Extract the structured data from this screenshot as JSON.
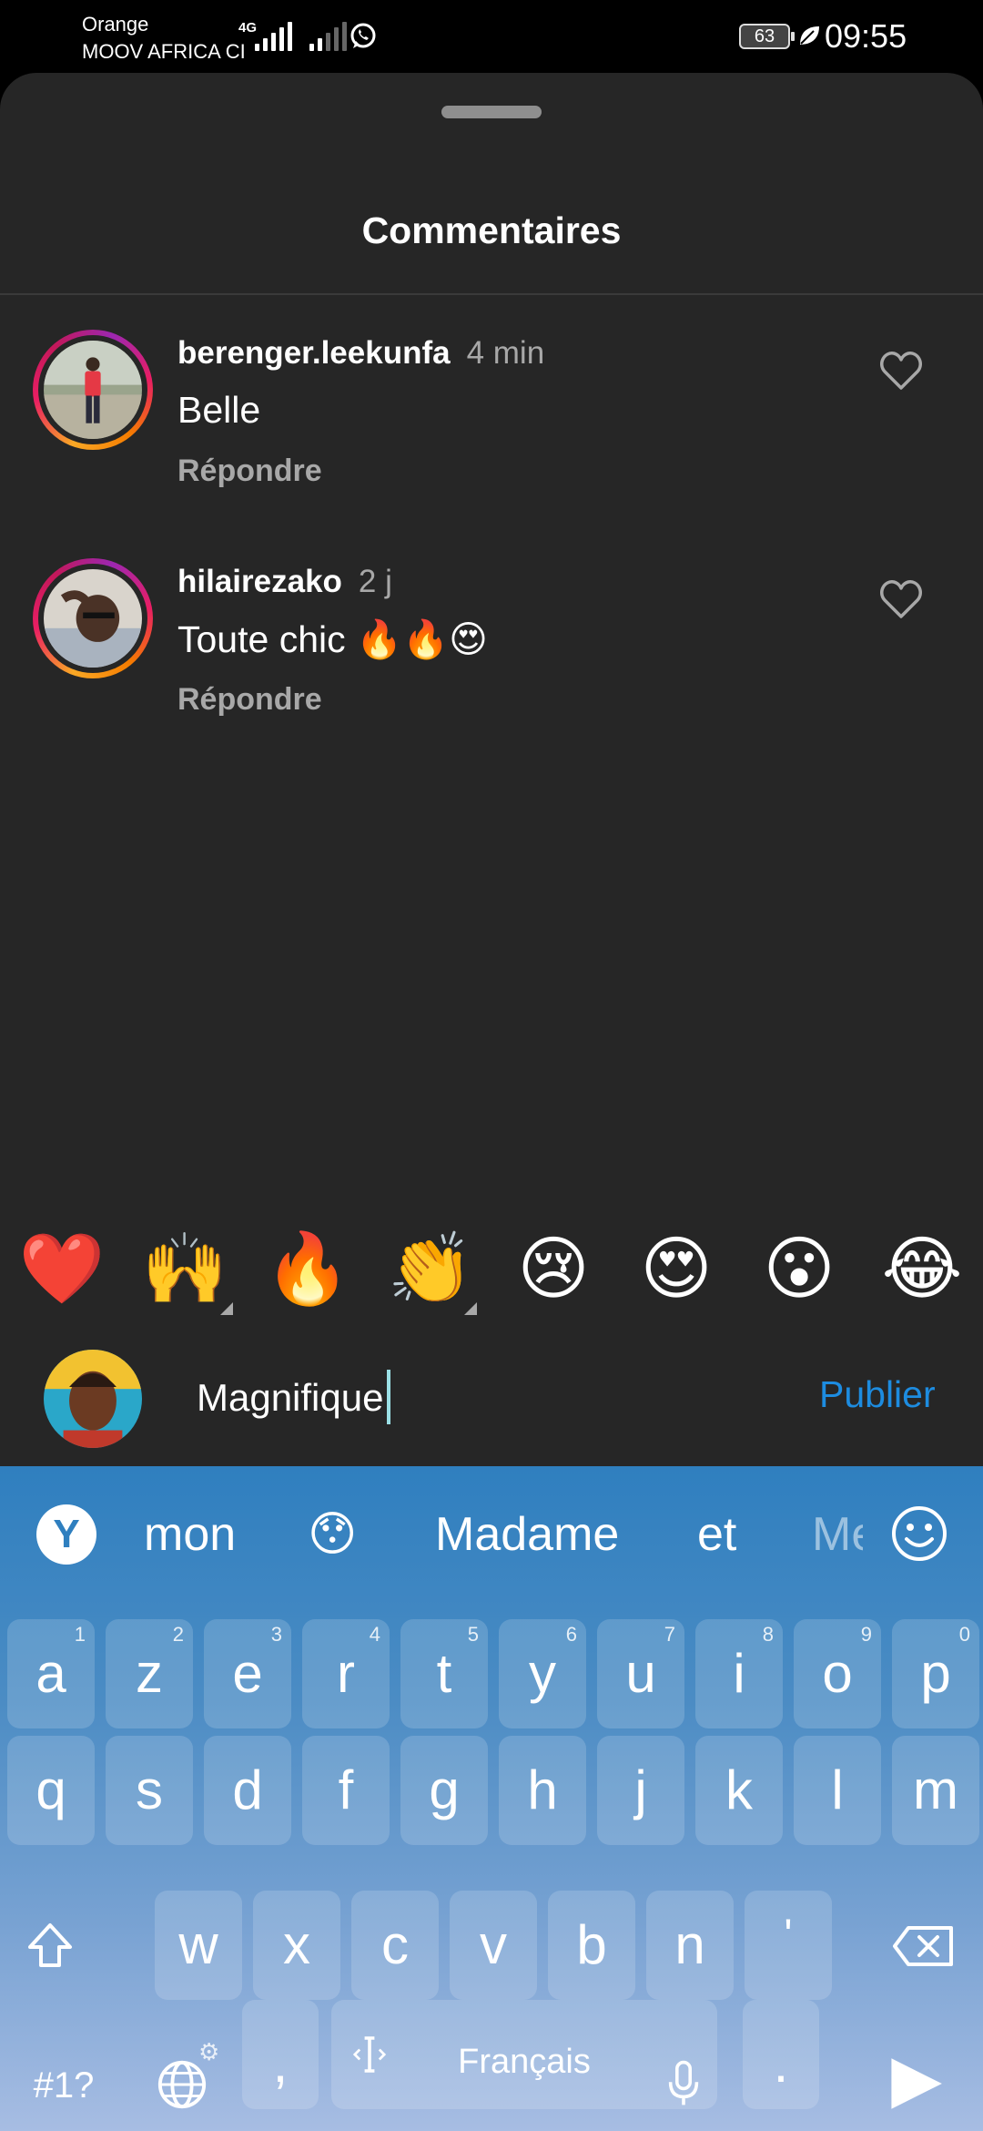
{
  "status_bar": {
    "carrier_1": "Orange",
    "carrier_2": "MOOV AFRICA CI",
    "network": "4G",
    "battery": "63",
    "time": "09:55"
  },
  "sheet": {
    "title": "Commentaires"
  },
  "comments": [
    {
      "username": "berenger.leekunfa",
      "time": "4 min",
      "text": "Belle",
      "reply_label": "Répondre"
    },
    {
      "username": "hilairezako",
      "time": "2 j",
      "text": "Toute chic 🔥🔥😍",
      "reply_label": "Répondre"
    }
  ],
  "reactions": [
    "❤️",
    "🙌",
    "🔥",
    "👏",
    "😢",
    "😍",
    "😮",
    "😂"
  ],
  "composer": {
    "value": "Magnifique",
    "publish_label": "Publier"
  },
  "keyboard": {
    "suggestions": [
      "mon",
      "😯",
      "Madame",
      "et",
      "Me"
    ],
    "row1": [
      {
        "k": "a",
        "h": "1"
      },
      {
        "k": "z",
        "h": "2"
      },
      {
        "k": "e",
        "h": "3"
      },
      {
        "k": "r",
        "h": "4"
      },
      {
        "k": "t",
        "h": "5"
      },
      {
        "k": "y",
        "h": "6"
      },
      {
        "k": "u",
        "h": "7"
      },
      {
        "k": "i",
        "h": "8"
      },
      {
        "k": "o",
        "h": "9"
      },
      {
        "k": "p",
        "h": "0"
      }
    ],
    "row2": [
      "q",
      "s",
      "d",
      "f",
      "g",
      "h",
      "j",
      "k",
      "l",
      "m"
    ],
    "row3": [
      "w",
      "x",
      "c",
      "v",
      "b",
      "n",
      "'"
    ],
    "symbols_label": "#1?",
    "comma_label": ",",
    "space_label": "Français",
    "period_label": ".",
    "accent_color": "#2f7fbf"
  }
}
